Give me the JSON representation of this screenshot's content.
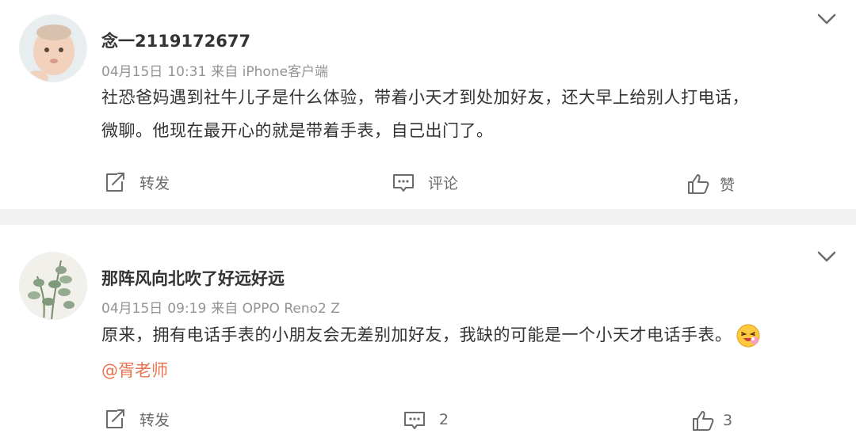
{
  "posts": [
    {
      "username": "念一2119172677",
      "date": "04月15日",
      "time": "10:31",
      "source": "来自 iPhone客户端",
      "text_lines": [
        "社恐爸妈遇到社牛儿子是什么体验，带着小天才到处加好友，还大早上给别人打电话，",
        "微聊。他现在最开心的就是带着手表，自己出门了。"
      ],
      "mention": "",
      "actions": {
        "repost": "转发",
        "comment": "评论",
        "like": "赞"
      },
      "avatar_icon": "baby-photo-avatar"
    },
    {
      "username": "那阵风向北吹了好远好远",
      "date": "04月15日",
      "time": "09:19",
      "source": "来自 OPPO Reno2 Z",
      "text_lines": [
        "原来，拥有电话手表的小朋友会无差别加好友，我缺的可能是一个小天才电话手表。"
      ],
      "mention": "@胥老师",
      "actions": {
        "repost": "转发",
        "comment": "2",
        "like": "3"
      },
      "avatar_icon": "plant-photo-avatar",
      "emoji": "laughing-emoji-icon"
    }
  ],
  "colors": {
    "username": "#333333",
    "meta": "#939393",
    "mention": "#eb7350",
    "divider": "#f2f2f2",
    "action_text": "#6b6b6b"
  }
}
